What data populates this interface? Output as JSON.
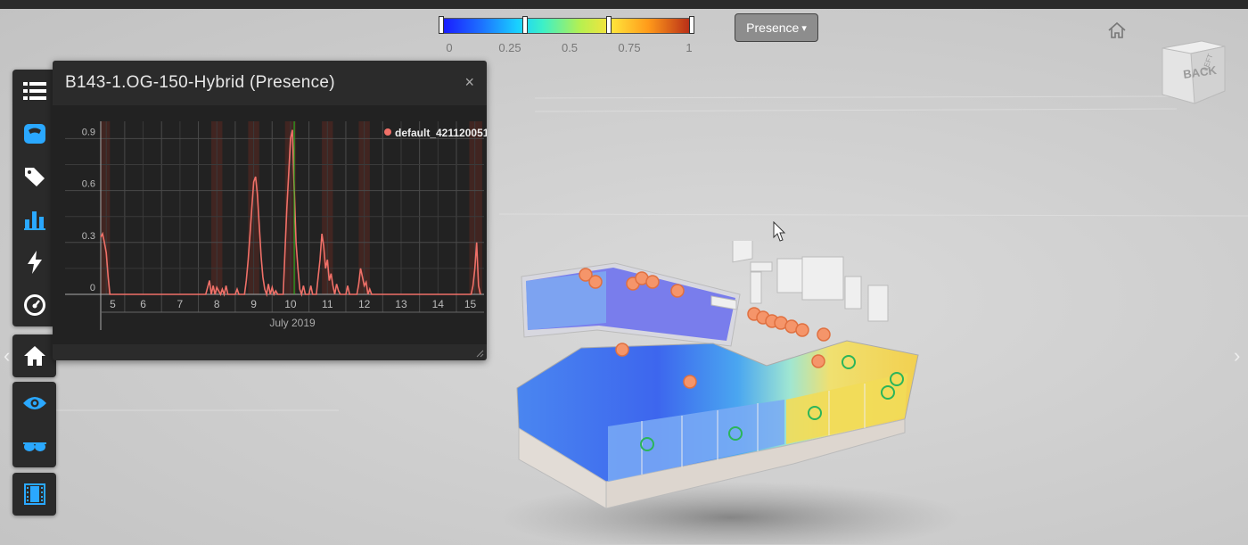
{
  "scale": {
    "labels": [
      "0",
      "0.25",
      "0.5",
      "0.75",
      "1"
    ],
    "mode_label": "Presence",
    "mode_caret": "▾"
  },
  "viewcube": {
    "label": "BACK",
    "side": "LEFT"
  },
  "panel": {
    "title": "B143-1.OG-150-Hybrid (Presence)",
    "close": "×"
  },
  "chart_data": {
    "type": "line",
    "title": "",
    "xlabel": "July 2019",
    "ylabel": "",
    "x_ticks": [
      "5",
      "6",
      "7",
      "8",
      "9",
      "10",
      "11",
      "12",
      "13",
      "14",
      "15"
    ],
    "y_ticks": [
      "0",
      "0.3",
      "0.6",
      "0.9"
    ],
    "ylim": [
      0,
      1
    ],
    "xlim": [
      4.85,
      15.25
    ],
    "grid": true,
    "legend_position": "top-right",
    "series": [
      {
        "name": "default_421120051",
        "color": "#f07068",
        "x": [
          4.85,
          4.9,
          4.95,
          5.0,
          5.05,
          5.1,
          5.15,
          7.7,
          7.8,
          7.85,
          7.9,
          7.95,
          8.0,
          8.05,
          8.1,
          8.15,
          8.2,
          8.25,
          8.3,
          8.5,
          8.55,
          8.6,
          8.75,
          8.8,
          8.85,
          8.9,
          8.95,
          9.0,
          9.05,
          9.1,
          9.15,
          9.2,
          9.25,
          9.3,
          9.35,
          9.4,
          9.45,
          9.5,
          9.55,
          9.6,
          9.65,
          9.7,
          9.8,
          9.85,
          9.9,
          9.95,
          10.0,
          10.05,
          10.1,
          10.15,
          10.2,
          10.25,
          10.3,
          10.35,
          10.4,
          10.5,
          10.55,
          10.6,
          10.7,
          10.75,
          10.8,
          10.85,
          10.9,
          10.95,
          11.0,
          11.05,
          11.1,
          11.15,
          11.2,
          11.25,
          11.3,
          11.35,
          11.4,
          11.5,
          11.55,
          11.6,
          11.8,
          11.85,
          11.9,
          11.95,
          12.0,
          12.05,
          12.1,
          12.15,
          12.2,
          14.9,
          14.95,
          15.0,
          15.05,
          15.1,
          15.15
        ],
        "y": [
          0.33,
          0.35,
          0.3,
          0.24,
          0.1,
          0.0,
          0.0,
          0.0,
          0.08,
          0.0,
          0.05,
          0.0,
          0.04,
          0.02,
          0.0,
          0.03,
          0.0,
          0.05,
          0.0,
          0.0,
          0.03,
          0.0,
          0.0,
          0.08,
          0.2,
          0.35,
          0.5,
          0.65,
          0.68,
          0.58,
          0.4,
          0.22,
          0.1,
          0.03,
          0.0,
          0.06,
          0.0,
          0.04,
          0.0,
          0.02,
          0.0,
          0.0,
          0.0,
          0.25,
          0.5,
          0.7,
          0.9,
          0.95,
          0.6,
          0.3,
          0.15,
          0.03,
          0.0,
          0.05,
          0.0,
          0.0,
          0.05,
          0.0,
          0.0,
          0.1,
          0.2,
          0.35,
          0.28,
          0.15,
          0.2,
          0.08,
          0.12,
          0.05,
          0.0,
          0.06,
          0.02,
          0.0,
          0.0,
          0.0,
          0.05,
          0.0,
          0.0,
          0.06,
          0.15,
          0.1,
          0.05,
          0.07,
          0.0,
          0.03,
          0.0,
          0.0,
          0.05,
          0.15,
          0.3,
          0.05,
          0.0
        ],
        "marker_x": 10.1
      }
    ],
    "shaded_bands": [
      [
        4.85,
        5.1
      ],
      [
        7.85,
        8.15
      ],
      [
        8.85,
        9.15
      ],
      [
        9.85,
        10.15
      ],
      [
        10.85,
        11.15
      ],
      [
        11.85,
        12.15
      ],
      [
        14.85,
        15.2
      ]
    ]
  },
  "colors": {
    "panel_bg": "#2b2b2b",
    "chart_bg": "#222222",
    "series": "#f07068",
    "marker_line": "#22c022",
    "tool_icon": "#ffffff",
    "tool_icon_active": "#2aa8ff",
    "sensor_orange": "#f5956a",
    "sensor_green": "#2bb55a"
  },
  "toolbar": {
    "icons": [
      "model-browser-icon",
      "sensor-icon",
      "tag-icon",
      "chart-icon",
      "energy-icon",
      "gauge-icon",
      "home-icon",
      "eye-icon",
      "glasses-icon",
      "film-icon"
    ]
  },
  "nav": {
    "left": "‹",
    "right": "›"
  }
}
